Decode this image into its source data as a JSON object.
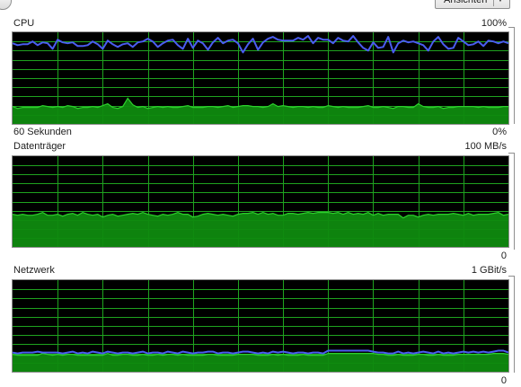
{
  "toolbar": {
    "view_button_label": "Ansichten",
    "view_button_arrow": "▼"
  },
  "colors": {
    "grid": "#1fa31f",
    "background": "#000000",
    "fill": "#0f8a0f",
    "fill_stroke": "#2cd02c",
    "cpu_line": "#4a5cf0"
  },
  "cpu": {
    "title": "CPU",
    "max_label": "100%",
    "time_label": "60 Sekunden",
    "min_label": "0%"
  },
  "disk": {
    "title": "Datenträger",
    "max_label": "100 MB/s",
    "min_label": "0"
  },
  "network": {
    "title": "Netzwerk",
    "max_label": "1 GBit/s",
    "min_label": "0"
  },
  "chart_data": [
    {
      "type": "area",
      "title": "CPU",
      "ylim": [
        0,
        100
      ],
      "series": [
        {
          "values": [
            88,
            86,
            87,
            87,
            90,
            86,
            89,
            88,
            82,
            92,
            89,
            88,
            89,
            85,
            85,
            86,
            90,
            87,
            82,
            91,
            87,
            84,
            87,
            88,
            84,
            89,
            90,
            93,
            90,
            84,
            88,
            91,
            92,
            86,
            82,
            93,
            83,
            91,
            88,
            81,
            89,
            94,
            88,
            91,
            92,
            88,
            78,
            87,
            93,
            81,
            89,
            93,
            95,
            92,
            91,
            91,
            91,
            94,
            92,
            96,
            88,
            94,
            92,
            92,
            88,
            94,
            91,
            90,
            96,
            89,
            83,
            80,
            89,
            83,
            84,
            95,
            78,
            88,
            91,
            89,
            90,
            88,
            86,
            80,
            90,
            95,
            87,
            82,
            83,
            94,
            90,
            86,
            87,
            90,
            85,
            91,
            90,
            88,
            90,
            88
          ]
        },
        {
          "values": [
            19,
            17,
            18,
            18,
            18,
            18,
            20,
            19,
            18,
            19,
            18,
            20,
            19,
            17,
            18,
            18,
            19,
            18,
            20,
            22,
            18,
            17,
            19,
            28,
            21,
            18,
            19,
            17,
            18,
            19,
            18,
            19,
            18,
            18,
            19,
            20,
            18,
            18,
            18,
            19,
            19,
            18,
            19,
            20,
            18,
            19,
            20,
            20,
            19,
            19,
            18,
            19,
            22,
            19,
            20,
            19,
            18,
            19,
            19,
            18,
            19,
            18,
            18,
            20,
            19,
            18,
            19,
            18,
            18,
            18,
            19,
            20,
            18,
            18,
            19,
            18,
            17,
            19,
            19,
            18,
            18,
            22,
            19,
            18,
            18,
            19,
            17,
            18,
            18,
            19,
            19,
            19,
            19,
            18,
            19,
            18,
            18,
            18,
            19,
            19
          ]
        }
      ]
    },
    {
      "type": "area",
      "title": "Datenträger",
      "ylim": [
        0,
        100
      ],
      "series": [
        {
          "values": [
            36,
            35,
            36,
            35,
            35,
            36,
            38,
            35,
            35,
            36,
            34,
            36,
            37,
            35,
            38,
            36,
            35,
            36,
            33,
            35,
            36,
            34,
            35,
            36,
            37,
            36,
            38,
            36,
            35,
            34,
            36,
            35,
            36,
            38,
            36,
            36,
            33,
            34,
            36,
            37,
            36,
            35,
            36,
            35,
            34,
            36,
            37,
            37,
            38,
            36,
            38,
            36,
            37,
            35,
            35,
            37,
            37,
            36,
            37,
            38,
            37,
            38,
            38,
            38,
            37,
            38,
            36,
            38,
            36,
            37,
            36,
            38,
            35,
            37,
            35,
            36,
            36,
            36,
            32,
            35,
            35,
            33,
            35,
            36,
            35,
            36,
            36,
            36,
            37,
            36,
            35,
            37,
            35,
            36,
            36,
            36,
            37,
            38,
            35,
            36
          ]
        }
      ]
    },
    {
      "type": "area",
      "title": "Netzwerk",
      "ylim": [
        0,
        100
      ],
      "series": [
        {
          "values": [
            19,
            18,
            18,
            18,
            18,
            18,
            20,
            19,
            18,
            19,
            18,
            19,
            19,
            18,
            18,
            18,
            18,
            18,
            18,
            20,
            18,
            18,
            19,
            19,
            18,
            18,
            19,
            18,
            18,
            19,
            18,
            19,
            19,
            18,
            19,
            18,
            18,
            18,
            18,
            19,
            19,
            18,
            18,
            18,
            18,
            19,
            19,
            19,
            19,
            18,
            18,
            18,
            19,
            18,
            19,
            18,
            18,
            18,
            19,
            18,
            18,
            18,
            18,
            20,
            20,
            20,
            20,
            20,
            20,
            20,
            20,
            20,
            20,
            19,
            19,
            18,
            18,
            19,
            18,
            18,
            18,
            19,
            19,
            18,
            18,
            19,
            18,
            18,
            18,
            19,
            19,
            19,
            19,
            19,
            19,
            19,
            20,
            20,
            20,
            19
          ]
        },
        {
          "values": [
            21,
            20,
            21,
            21,
            21,
            22,
            21,
            21,
            21,
            21,
            20,
            21,
            22,
            20,
            21,
            20,
            22,
            21,
            20,
            22,
            21,
            20,
            21,
            21,
            20,
            21,
            22,
            20,
            21,
            21,
            20,
            22,
            21,
            20,
            22,
            21,
            20,
            21,
            21,
            22,
            22,
            20,
            21,
            21,
            20,
            21,
            22,
            22,
            21,
            20,
            21,
            20,
            22,
            21,
            22,
            21,
            20,
            21,
            21,
            20,
            21,
            21,
            20,
            23,
            23,
            23,
            23,
            23,
            23,
            23,
            23,
            23,
            22,
            21,
            21,
            20,
            20,
            22,
            20,
            21,
            20,
            21,
            22,
            21,
            20,
            22,
            20,
            21,
            20,
            21,
            22,
            21,
            22,
            21,
            22,
            21,
            22,
            23,
            23,
            21
          ]
        }
      ]
    }
  ]
}
